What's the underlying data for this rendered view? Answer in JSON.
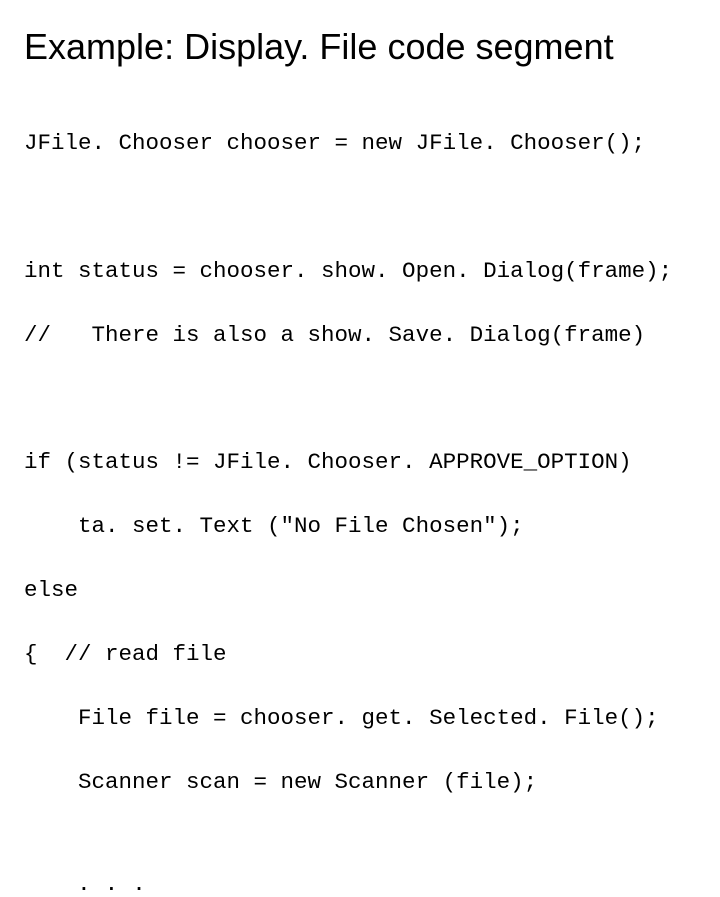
{
  "title": "Example: Display. File code segment",
  "code": {
    "l1": "JFile. Chooser chooser = new JFile. Chooser();",
    "l2": "int status = chooser. show. Open. Dialog(frame);",
    "l3": "//   There is also a show. Save. Dialog(frame)",
    "l4": "if (status != JFile. Chooser. APPROVE_OPTION)",
    "l5": "    ta. set. Text (\"No File Chosen\");",
    "l6": "else",
    "l7": "{  // read file",
    "l8": "    File file = chooser. get. Selected. File();",
    "l9": "    Scanner scan = new Scanner (file);"
  },
  "dots": ". . ."
}
